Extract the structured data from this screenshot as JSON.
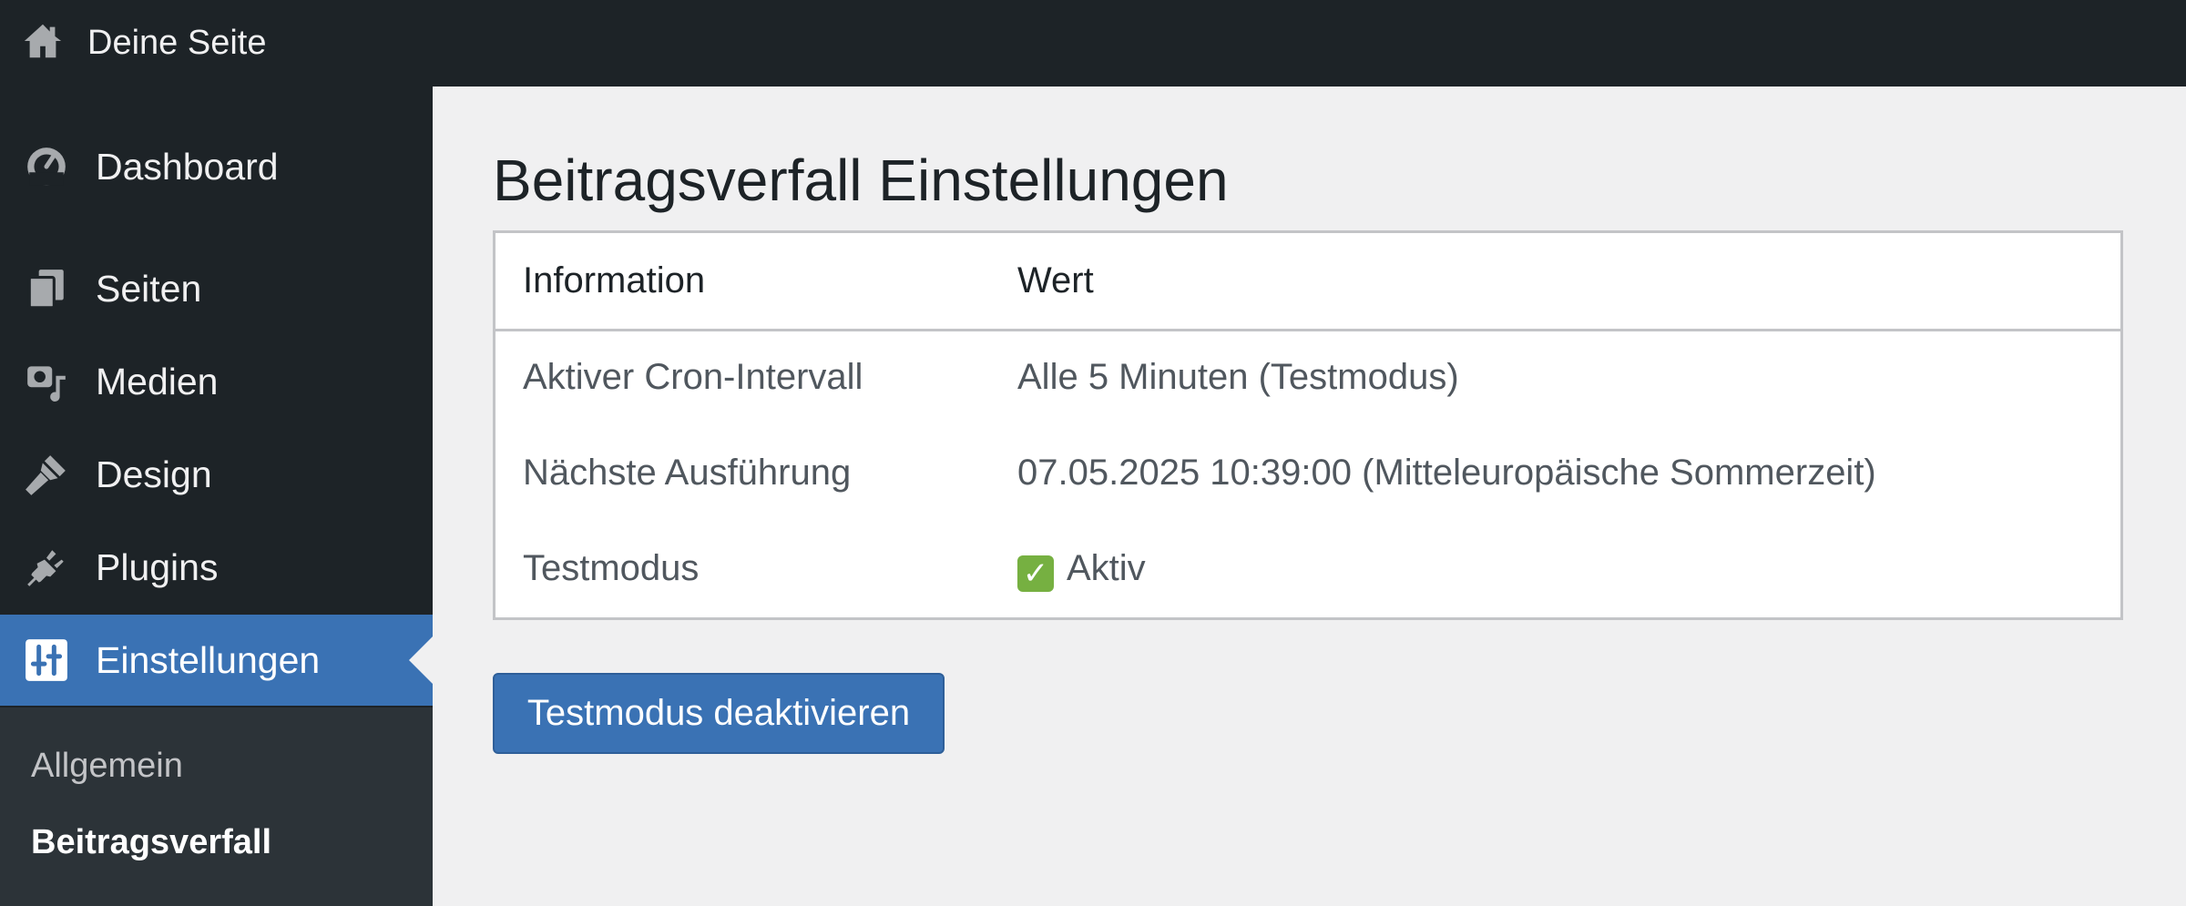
{
  "adminbar": {
    "site_name": "Deine Seite",
    "home_icon": "home-icon"
  },
  "sidebar": {
    "items": [
      {
        "label": "Dashboard",
        "icon": "dashboard-icon"
      },
      {
        "label": "Seiten",
        "icon": "pages-icon"
      },
      {
        "label": "Medien",
        "icon": "media-icon"
      },
      {
        "label": "Design",
        "icon": "brush-icon"
      },
      {
        "label": "Plugins",
        "icon": "plugin-icon"
      },
      {
        "label": "Einstellungen",
        "icon": "settings-icon",
        "current": true
      }
    ],
    "submenu": [
      {
        "label": "Allgemein"
      },
      {
        "label": "Beitragsverfall",
        "active": true
      }
    ]
  },
  "main": {
    "title": "Beitragsverfall Einstellungen",
    "table": {
      "headers": [
        "Information",
        "Wert"
      ],
      "rows": [
        {
          "label": "Aktiver Cron-Intervall",
          "value": "Alle 5 Minuten (Testmodus)"
        },
        {
          "label": "Nächste Ausführung",
          "value": "07.05.2025 10:39:00 (Mitteleuropäische Sommerzeit)"
        },
        {
          "label": "Testmodus",
          "value": "Aktiv",
          "status_icon": "check-icon"
        }
      ]
    },
    "button_label": "Testmodus deaktivieren"
  },
  "colors": {
    "admin_dark": "#1d2327",
    "submenu_bg": "#2c3338",
    "accent_blue": "#3a72b4",
    "page_bg": "#f0f0f1",
    "check_green": "#76b041"
  }
}
